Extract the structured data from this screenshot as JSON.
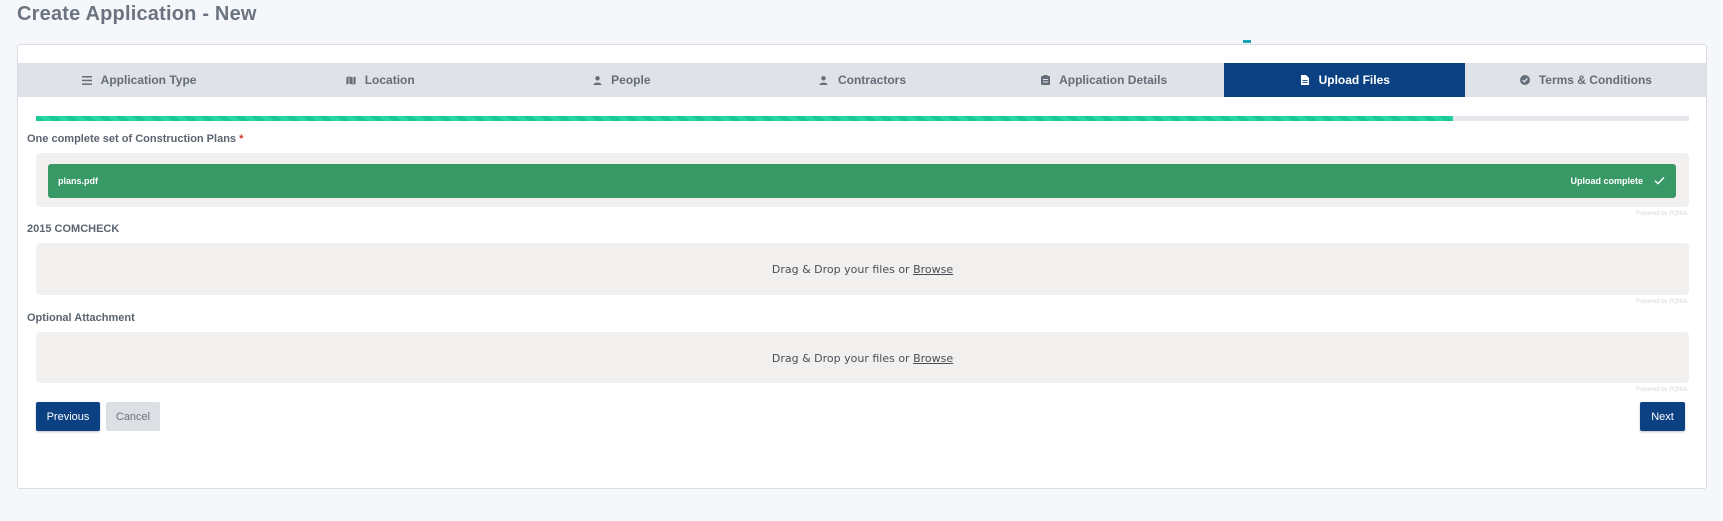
{
  "page": {
    "title": "Create Application - New"
  },
  "tabs": [
    {
      "label": "Application Type",
      "icon": "list-icon",
      "active": false
    },
    {
      "label": "Location",
      "icon": "map-icon",
      "active": false
    },
    {
      "label": "People",
      "icon": "user-icon",
      "active": false
    },
    {
      "label": "Contractors",
      "icon": "user-icon",
      "active": false
    },
    {
      "label": "Application Details",
      "icon": "clipboard-icon",
      "active": false
    },
    {
      "label": "Upload Files",
      "icon": "file-icon",
      "active": true
    },
    {
      "label": "Terms & Conditions",
      "icon": "check-circle-icon",
      "active": false
    }
  ],
  "progress": {
    "fraction": 0.857
  },
  "uploads": [
    {
      "label": "One complete set of Construction Plans",
      "required_mark": "*",
      "file_name": "plans.pdf",
      "status": "Upload complete",
      "powered_by": "Powered by PQINA"
    },
    {
      "label": "2015 COMCHECK",
      "drop_text": "Drag & Drop your files or",
      "browse": "Browse",
      "powered_by": "Powered by PQINA"
    },
    {
      "label": "Optional Attachment",
      "drop_text": "Drag & Drop your files or",
      "browse": "Browse",
      "powered_by": "Powered by PQINA"
    }
  ],
  "buttons": {
    "previous": "Previous",
    "cancel": "Cancel",
    "next": "Next"
  },
  "colors": {
    "primary": "#0b4182",
    "success": "#389966",
    "progress": "#1cc896",
    "required": "#d0342c"
  }
}
